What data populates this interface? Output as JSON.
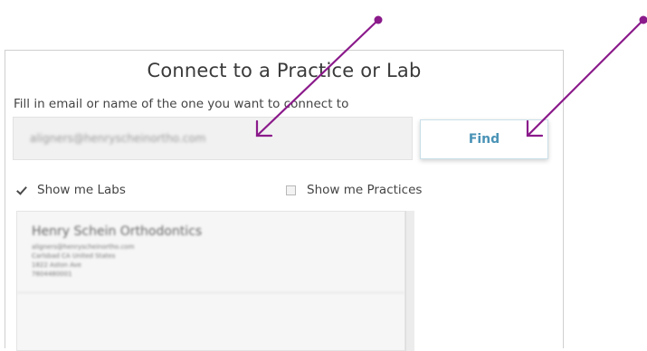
{
  "dialog": {
    "title": "Connect to a Practice or Lab",
    "instruction": "Fill in email or name of the one you want to connect to",
    "search_value": "aligners@henryscheinortho.com",
    "find_label": "Find",
    "show_labs_label": "Show me Labs",
    "show_labs_checked": true,
    "show_practices_label": "Show me Practices",
    "show_practices_checked": false
  },
  "results": [
    {
      "name": "Henry Schein Orthodontics",
      "lines": [
        "aligners@henryscheinortho.com",
        "Carlsbad CA United States",
        "1822 Aston Ave",
        "7604480001"
      ]
    }
  ],
  "colors": {
    "annotation_arrow": "#8b1a8b",
    "find_text": "#4a93b6"
  },
  "icons": {
    "checkbox_checked": "checkmark-icon",
    "annotation": "arrow-pointer-icon"
  }
}
